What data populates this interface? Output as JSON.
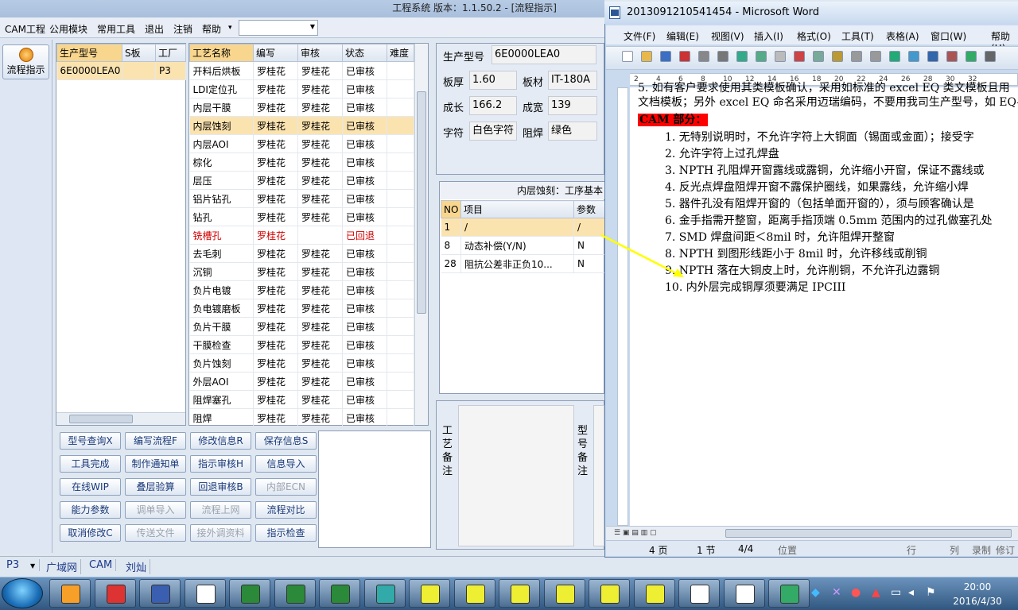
{
  "app": {
    "title": "工程系统  版本：1.1.50.2 - [流程指示]",
    "menu": [
      "CAM工程",
      "公用模块",
      "常用工具",
      "退出",
      "注销",
      "帮助"
    ],
    "menu_arrow": "▾"
  },
  "left": {
    "flow_button": "流程指示"
  },
  "product_list": {
    "headers": [
      "生产型号",
      "S板",
      "工厂"
    ],
    "rows": [
      {
        "model": "6E0000LEA0",
        "s": "",
        "factory": "P3"
      }
    ]
  },
  "process_table": {
    "headers": [
      "工艺名称",
      "编写",
      "审核",
      "状态",
      "难度"
    ],
    "rows": [
      [
        "开料后烘板",
        "罗桂花",
        "罗桂花",
        "已审核"
      ],
      [
        "LDI定位孔",
        "罗桂花",
        "罗桂花",
        "已审核"
      ],
      [
        "内层干膜",
        "罗桂花",
        "罗桂花",
        "已审核"
      ],
      [
        "内层蚀刻",
        "罗桂花",
        "罗桂花",
        "已审核"
      ],
      [
        "内层AOI",
        "罗桂花",
        "罗桂花",
        "已审核"
      ],
      [
        "棕化",
        "罗桂花",
        "罗桂花",
        "已审核"
      ],
      [
        "层压",
        "罗桂花",
        "罗桂花",
        "已审核"
      ],
      [
        "铝片钻孔",
        "罗桂花",
        "罗桂花",
        "已审核"
      ],
      [
        "钻孔",
        "罗桂花",
        "罗桂花",
        "已审核"
      ],
      [
        "铣槽孔",
        "罗桂花",
        "",
        "已回退"
      ],
      [
        "去毛刺",
        "罗桂花",
        "罗桂花",
        "已审核"
      ],
      [
        "沉铜",
        "罗桂花",
        "罗桂花",
        "已审核"
      ],
      [
        "负片电镀",
        "罗桂花",
        "罗桂花",
        "已审核"
      ],
      [
        "负电镀磨板",
        "罗桂花",
        "罗桂花",
        "已审核"
      ],
      [
        "负片干膜",
        "罗桂花",
        "罗桂花",
        "已审核"
      ],
      [
        "干膜检查",
        "罗桂花",
        "罗桂花",
        "已审核"
      ],
      [
        "负片蚀刻",
        "罗桂花",
        "罗桂花",
        "已审核"
      ],
      [
        "外层AOI",
        "罗桂花",
        "罗桂花",
        "已审核"
      ],
      [
        "阻焊塞孔",
        "罗桂花",
        "罗桂花",
        "已审核"
      ],
      [
        "阻焊",
        "罗桂花",
        "罗桂花",
        "已审核"
      ]
    ]
  },
  "buttons": [
    [
      "型号查询X",
      "编写流程F",
      "修改信息R",
      "保存信息S"
    ],
    [
      "工具完成",
      "制作通知单",
      "指示审核H",
      "信息导入"
    ],
    [
      "在线WIP",
      "叠层验算",
      "回退审核B",
      "内部ECN"
    ],
    [
      "能力参数",
      "调单导入",
      "流程上网",
      "流程对比"
    ],
    [
      "取消修改C",
      "传送文件",
      "接外调资料",
      "指示检查"
    ]
  ],
  "info": {
    "model_label": "生产型号",
    "model": "6E0000LEA0",
    "thickness_label": "板厚",
    "thickness": "1.60",
    "material_label": "板材",
    "material": "IT-180A",
    "length_label": "成长",
    "length": "166.2",
    "width_label": "成宽",
    "width": "139",
    "text_label": "字符",
    "text": "白色字符",
    "mask_label": "阻焊",
    "mask": "绿色"
  },
  "params": {
    "title": "内层蚀刻：工序基本",
    "headers": [
      "NO",
      "项目",
      "参数"
    ],
    "rows": [
      [
        "1",
        "/",
        "/"
      ],
      [
        "8",
        "动态补偿(Y/N)",
        "N"
      ],
      [
        "28",
        "阻抗公差非正负10...",
        "N"
      ]
    ]
  },
  "notes": {
    "process_label": "工艺备注",
    "model_label": "型号备注"
  },
  "statusbar": {
    "factory": "P3",
    "network": "广域网",
    "dept": "CAM",
    "user": "刘灿"
  },
  "word": {
    "title": "2013091210541454 - Microsoft Word",
    "menu": [
      "文件(F)",
      "编辑(E)",
      "视图(V)",
      "插入(I)",
      "格式(O)",
      "工具(T)",
      "表格(A)",
      "窗口(W)",
      "帮助(H)"
    ],
    "ruler": [
      "2",
      "4",
      "6",
      "8",
      "10",
      "12",
      "14",
      "16",
      "18",
      "20",
      "22",
      "24",
      "26",
      "28",
      "30",
      "32"
    ],
    "lines": [
      "5.  如有客户要求使用其类模板确认，采用如标准的 excel EQ 类文模板且用",
      "文档模板；另外 excel EQ 命名采用迈瑞编码，不要用我司生产型号，如 EQ-I-",
      "CAM 部分：",
      "1.  无特别说明时，不允许字符上大铜面（锡面或金面）；接受字",
      "2.  允许字符上过孔焊盘",
      "3.  NPTH 孔阻焊开窗露线或露铜，允许缩小开窗，保证不露线或",
      "4.  反光点焊盘阻焊开窗不露保护圈线，如果露线，允许缩小焊",
      "5.  器件孔没有阻焊开窗的（包括单面开窗的），须与顾客确认是",
      "6.  金手指需开整窗，距离手指顶端 0.5mm 范围内的过孔做塞孔处",
      "7.  SMD 焊盘间距＜8mil 时，允许阻焊开整窗",
      "8.  NPTH 到图形线距小于 8mil 时，允许移线或削铜",
      "9.  NPTH 落在大铜皮上时，允许削铜，不允许孔边露铜",
      "10. 内外层完成铜厚须要满足 IPCIII"
    ],
    "status": {
      "page": "4 页",
      "section": "1 节",
      "pages": "4/4",
      "pos": "位置",
      "row": "行",
      "col": "列",
      "rec": "录制",
      "rev": "修订"
    }
  },
  "taskbar": {
    "time": "20:00",
    "date": "2016/4/30"
  }
}
